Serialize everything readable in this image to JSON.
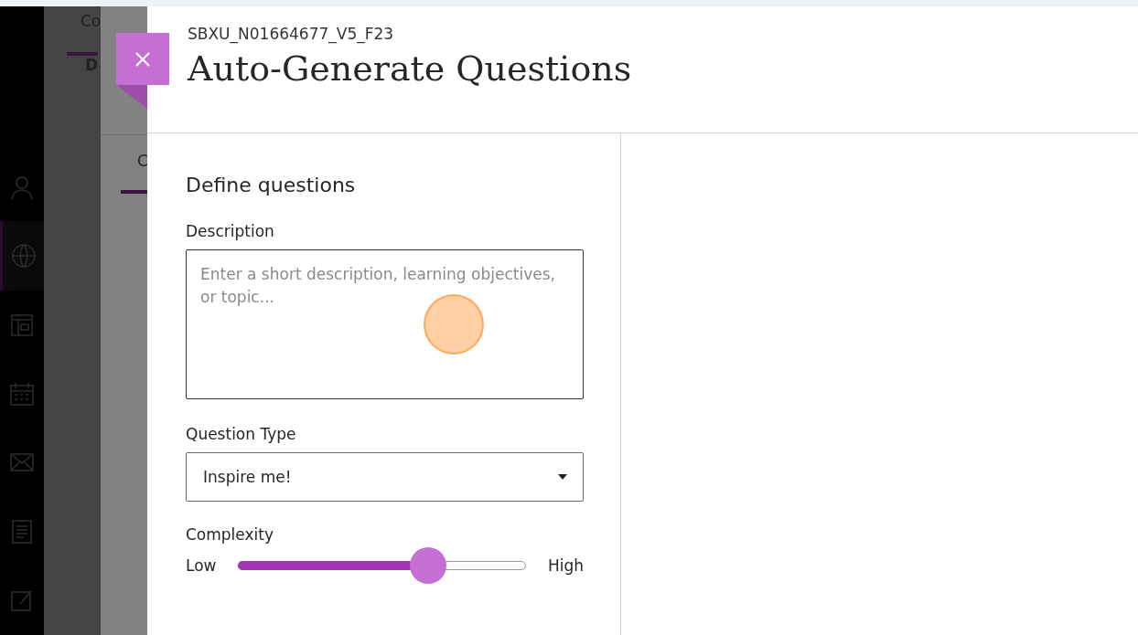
{
  "background_tabs": [
    {
      "label": "Co"
    },
    {
      "label": "D"
    },
    {
      "label": "C"
    }
  ],
  "panel": {
    "course_id": "SBXU_N01664677_V5_F23",
    "title": "Auto-Generate Questions"
  },
  "form": {
    "heading": "Define questions",
    "description": {
      "label": "Description",
      "placeholder": "Enter a short description, learning objectives, or topic..."
    },
    "question_type": {
      "label": "Question Type",
      "value": "Inspire me!"
    },
    "complexity": {
      "label": "Complexity",
      "low": "Low",
      "high": "High",
      "level": 0.66
    }
  }
}
